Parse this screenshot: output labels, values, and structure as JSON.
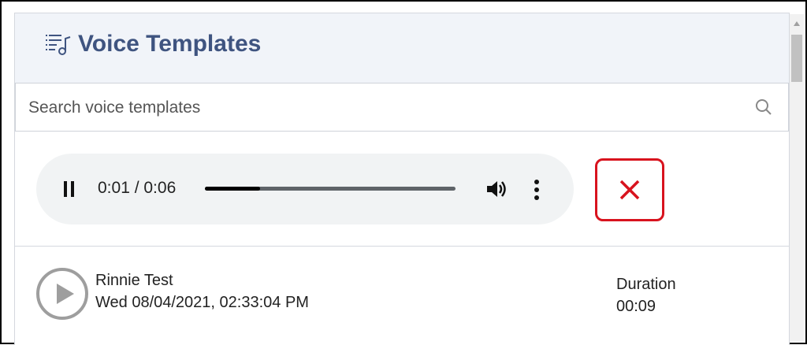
{
  "header": {
    "title": "Voice Templates",
    "icon": "playlist-music-icon"
  },
  "search": {
    "placeholder": "Search voice templates",
    "value": ""
  },
  "player": {
    "time": "0:01 / 0:06",
    "progress": 0.22,
    "pause_icon": "pause-icon",
    "volume_icon": "volume-icon",
    "more_icon": "more-vert-icon"
  },
  "close_button": {
    "icon": "close-icon",
    "color": "#d8131e"
  },
  "templates": [
    {
      "name": "Rinnie Test",
      "date": "Wed 08/04/2021, 02:33:04 PM",
      "duration_label": "Duration",
      "duration": "00:09"
    }
  ],
  "colors": {
    "accent": "#3f5480",
    "header_bg": "#f1f4f9",
    "danger": "#d8131e"
  }
}
